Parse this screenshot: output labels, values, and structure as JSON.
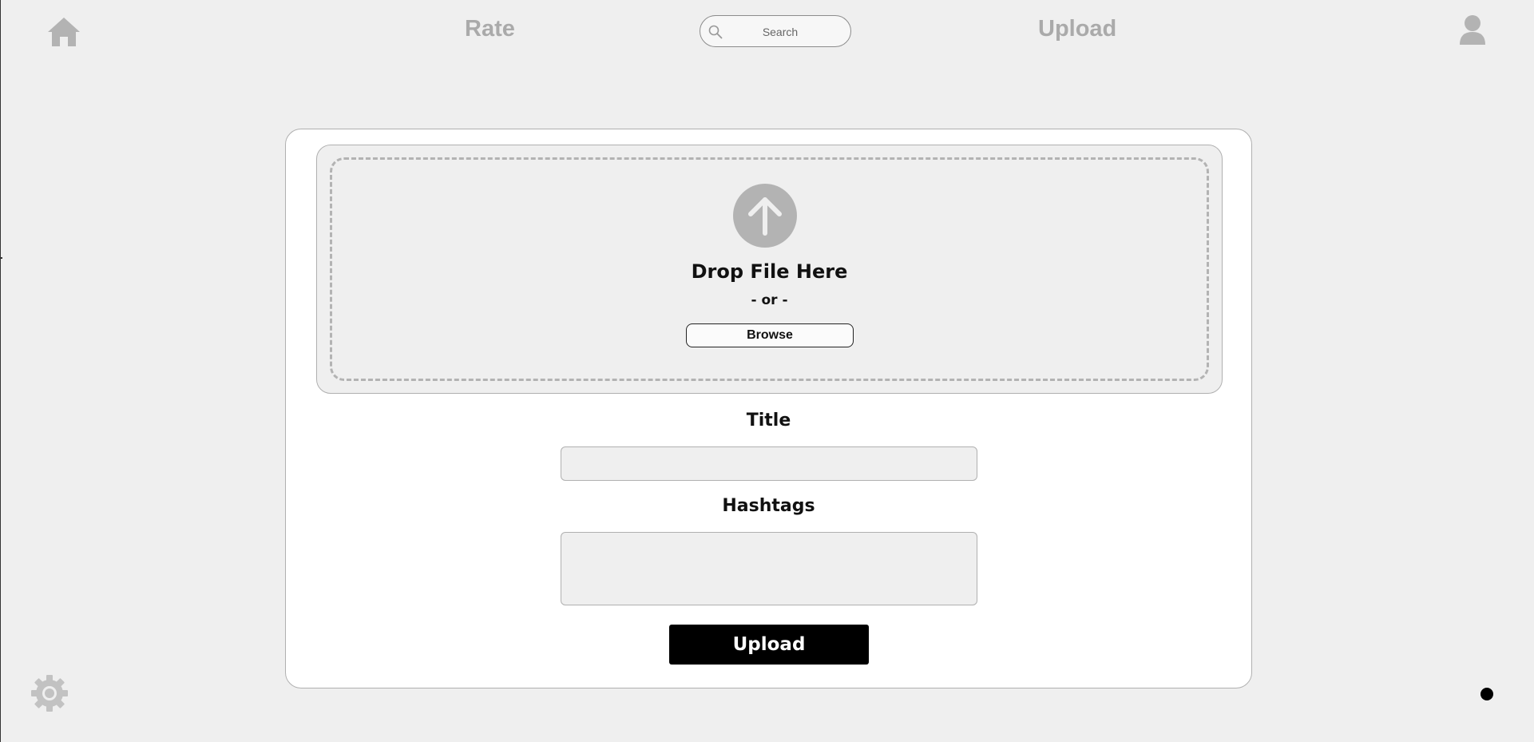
{
  "nav": {
    "home_icon": "home-icon",
    "rate_label": "Rate",
    "upload_label": "Upload",
    "search": {
      "placeholder": "Search",
      "value": "",
      "icon": "search-icon"
    },
    "profile_icon": "user-icon"
  },
  "upload_form": {
    "dropzone": {
      "icon": "upload-arrow-icon",
      "drop_text": "Drop File Here",
      "or_text": "- or -",
      "browse_label": "Browse"
    },
    "title_label": "Title",
    "title_value": "",
    "hashtags_label": "Hashtags",
    "hashtags_value": "",
    "submit_label": "Upload"
  },
  "footer": {
    "settings_icon": "gear-icon"
  },
  "colors": {
    "background": "#efefef",
    "card": "#ffffff",
    "nav_text": "#aaaaaa",
    "icon_gray": "#b3b3b3",
    "primary_button": "#000000"
  }
}
